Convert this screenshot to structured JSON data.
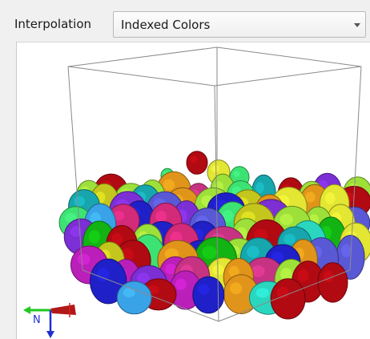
{
  "toolbar": {
    "interpolation_label": "Interpolation",
    "interpolation_value": "Indexed Colors"
  },
  "triad": {
    "axis_label": "N",
    "x_color": "#d81e1e",
    "y_color": "#21c821",
    "z_color": "#1f2fd0"
  },
  "render": {
    "background": "#ffffff",
    "box_outline": "#8a8a8a",
    "palette": [
      "#2020c8",
      "#e0951a",
      "#e3e632",
      "#17a6ad",
      "#2ad7be",
      "#ba1fba",
      "#b10a12",
      "#9ee03a",
      "#c63383",
      "#13b313",
      "#7c2fd4",
      "#3aa2e6",
      "#3ce373",
      "#c4c61d",
      "#d42a7a",
      "#5959d6"
    ]
  }
}
